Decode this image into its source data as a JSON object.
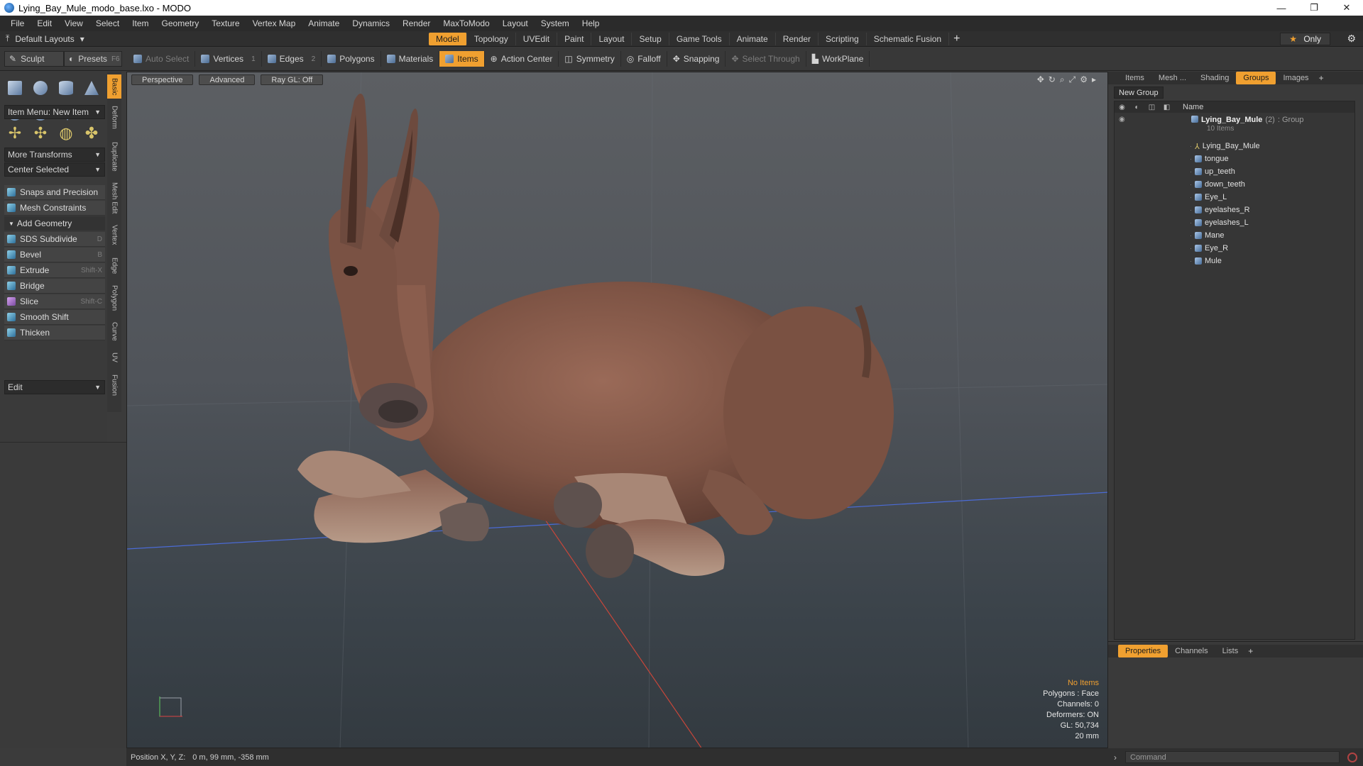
{
  "window": {
    "title": "Lying_Bay_Mule_modo_base.lxo - MODO",
    "minimize": "—",
    "maximize": "❐",
    "close": "✕"
  },
  "menu": [
    "File",
    "Edit",
    "View",
    "Select",
    "Item",
    "Geometry",
    "Texture",
    "Vertex Map",
    "Animate",
    "Dynamics",
    "Render",
    "MaxToModo",
    "Layout",
    "System",
    "Help"
  ],
  "layouts": {
    "menu_label": "Default Layouts",
    "tabs": [
      "Model",
      "Topology",
      "UVEdit",
      "Paint",
      "Layout",
      "Setup",
      "Game Tools",
      "Animate",
      "Render",
      "Scripting",
      "Schematic Fusion"
    ],
    "active_tab": "Model",
    "add": "+",
    "only_label": "Only",
    "gear": "⚙"
  },
  "toolbar": {
    "sculpt": "Sculpt",
    "presets": "Presets",
    "presets_key": "F6",
    "buttons": [
      {
        "label": "Auto Select",
        "num": ""
      },
      {
        "label": "Vertices",
        "num": "1"
      },
      {
        "label": "Edges",
        "num": "2"
      },
      {
        "label": "Polygons",
        "num": ""
      },
      {
        "label": "Materials",
        "num": ""
      },
      {
        "label": "Items",
        "num": ""
      },
      {
        "label": "Action Center",
        "num": ""
      },
      {
        "label": "Symmetry",
        "num": ""
      },
      {
        "label": "Falloff",
        "num": ""
      },
      {
        "label": "Snapping",
        "num": ""
      },
      {
        "label": "Select Through",
        "num": ""
      },
      {
        "label": "WorkPlane",
        "num": ""
      }
    ]
  },
  "leftpanel": {
    "item_menu": "Item Menu: New Item",
    "more_transforms": "More Transforms",
    "center_selected": "Center Selected",
    "snaps": "Snaps and Precision",
    "mesh_constraints": "Mesh Constraints",
    "add_geometry": "Add Geometry",
    "tools": [
      {
        "label": "SDS Subdivide",
        "key": "D"
      },
      {
        "label": "Bevel",
        "key": "B"
      },
      {
        "label": "Extrude",
        "key": "Shift-X"
      },
      {
        "label": "Bridge",
        "key": ""
      },
      {
        "label": "Slice",
        "key": "Shift-C"
      },
      {
        "label": "Smooth Shift",
        "key": ""
      },
      {
        "label": "Thicken",
        "key": ""
      }
    ],
    "edit": "Edit"
  },
  "vtabs": [
    "Basic",
    "Deform",
    "Duplicate",
    "Mesh Edit",
    "Vertex",
    "Edge",
    "Polygon",
    "Curve",
    "UV",
    "Fusion"
  ],
  "viewport": {
    "view": "Perspective",
    "shading": "Advanced",
    "raygl": "Ray GL: Off",
    "stats": {
      "items": "No Items",
      "polygons": "Polygons : Face",
      "channels": "Channels: 0",
      "deformers": "Deformers: ON",
      "gl": "GL: 50,734",
      "scale": "20 mm"
    }
  },
  "status": {
    "label": "Position X, Y, Z:",
    "value": "0 m, 99 mm, -358 mm"
  },
  "rightpanel": {
    "tabs": [
      "Items",
      "Mesh ...",
      "Shading",
      "Groups",
      "Images"
    ],
    "active_tab": "Groups",
    "new_group": "New Group",
    "name_header": "Name",
    "group": {
      "name": "Lying_Bay_Mule",
      "count": "(2)",
      "type": ": Group",
      "sub": "10 Items"
    },
    "items": [
      "Lying_Bay_Mule",
      "tongue",
      "up_teeth",
      "down_teeth",
      "Eye_L",
      "eyelashes_R",
      "eyelashes_L",
      "Mane",
      "Eye_R",
      "Mule"
    ]
  },
  "propspanel": {
    "tabs": [
      "Properties",
      "Channels",
      "Lists"
    ],
    "active_tab": "Properties"
  },
  "command": {
    "placeholder": "Command"
  },
  "colors": {
    "accent": "#f0a030",
    "background": "#3b3b3b",
    "viewport_top": "#5c5f63",
    "viewport_bottom": "#333a40"
  }
}
